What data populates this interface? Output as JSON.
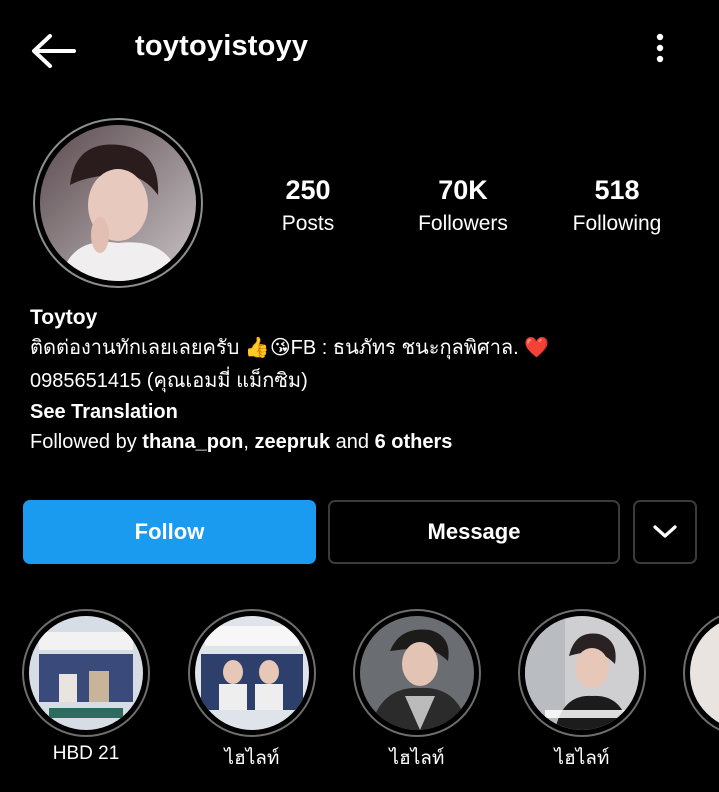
{
  "header": {
    "username": "toytoyistoyy",
    "back_icon": "arrow-left-icon",
    "menu_icon": "more-vertical-icon"
  },
  "stats": {
    "posts": {
      "value": "250",
      "label": "Posts"
    },
    "followers": {
      "value": "70K",
      "label": "Followers"
    },
    "following": {
      "value": "518",
      "label": "Following"
    }
  },
  "bio": {
    "name": "Toytoy",
    "line1": "ติดต่องานทักเลยเลยครับ  👍😘FB : ธนภัทร ชนะกุลพิศาล. ❤️",
    "line2": "0985651415 (คุณเอมมี่ แม็กซิม)",
    "see_translation": "See Translation",
    "followed_by_prefix": "Followed by ",
    "followed_user1": "thana_pon",
    "followed_sep": ", ",
    "followed_user2": "zeepruk",
    "followed_and": " and ",
    "followed_others": "6 others"
  },
  "actions": {
    "follow": "Follow",
    "message": "Message",
    "dropdown_icon": "chevron-down-icon"
  },
  "highlights": [
    {
      "label": "HBD 21"
    },
    {
      "label": "ไฮไลท์"
    },
    {
      "label": "ไฮไลท์"
    },
    {
      "label": "ไฮไลท์"
    }
  ],
  "colors": {
    "background": "#000000",
    "follow_button": "#1a9bf0",
    "button_border": "#3b3b3b",
    "ring": "#8e8e8e"
  }
}
